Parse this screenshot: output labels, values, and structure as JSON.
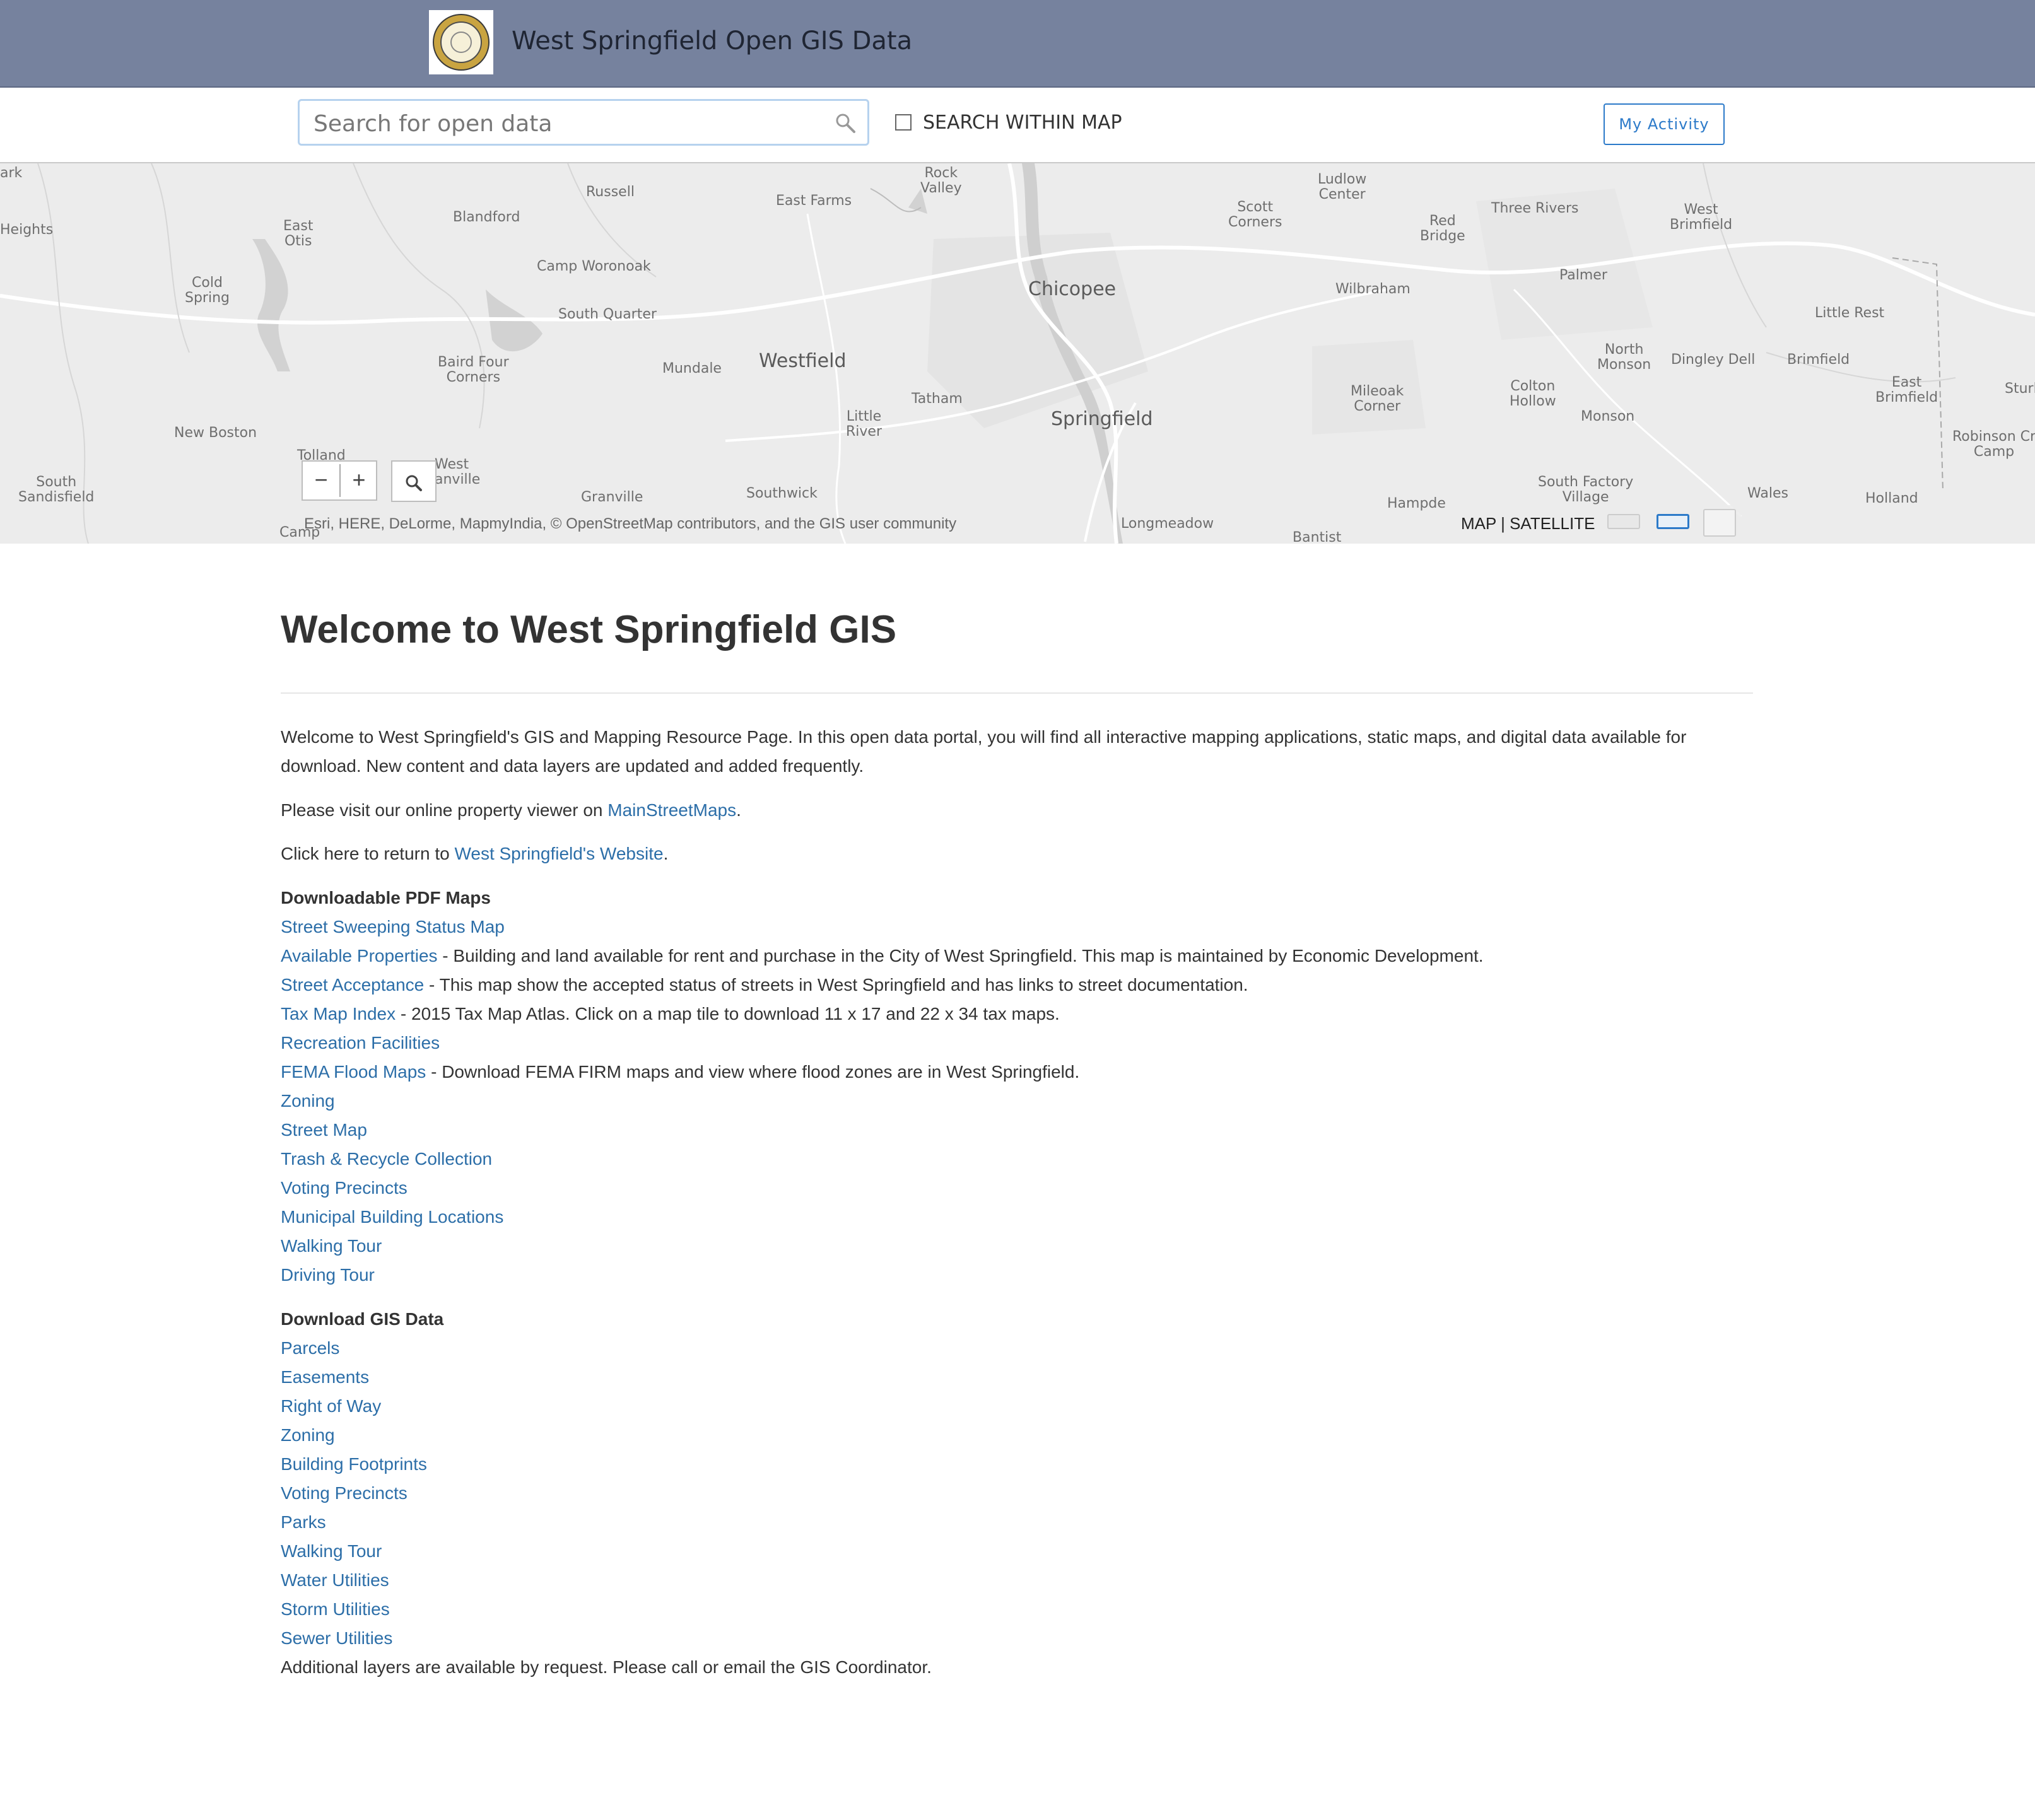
{
  "header": {
    "site_title": "West Springfield Open GIS Data"
  },
  "search": {
    "placeholder": "Search for open data",
    "value": "",
    "within_map_label": "SEARCH WITHIN MAP",
    "within_map_checked": false
  },
  "activity_button": "My Activity",
  "map": {
    "places": [
      {
        "name": "ark",
        "cls": ""
      },
      {
        "name": "Heights",
        "cls": ""
      },
      {
        "name": "East\nOtis",
        "cls": ""
      },
      {
        "name": "Cold\nSpring",
        "cls": ""
      },
      {
        "name": "Blandford",
        "cls": ""
      },
      {
        "name": "Russell",
        "cls": ""
      },
      {
        "name": "East Farms",
        "cls": ""
      },
      {
        "name": "Rock\nValley",
        "cls": ""
      },
      {
        "name": "Ludlow\nCenter",
        "cls": ""
      },
      {
        "name": "Scott\nCorners",
        "cls": ""
      },
      {
        "name": "Red\nBridge",
        "cls": ""
      },
      {
        "name": "Three Rivers",
        "cls": ""
      },
      {
        "name": "West\nBrimfield",
        "cls": ""
      },
      {
        "name": "Camp Woronoak",
        "cls": ""
      },
      {
        "name": "Chicopee",
        "cls": "big"
      },
      {
        "name": "Wilbraham",
        "cls": ""
      },
      {
        "name": "Palmer",
        "cls": ""
      },
      {
        "name": "South Quarter",
        "cls": ""
      },
      {
        "name": "Little Rest",
        "cls": ""
      },
      {
        "name": "Baird Four\nCorners",
        "cls": ""
      },
      {
        "name": "Mundale",
        "cls": ""
      },
      {
        "name": "Westfield",
        "cls": "big"
      },
      {
        "name": "North\nMonson",
        "cls": ""
      },
      {
        "name": "Dingley Dell",
        "cls": ""
      },
      {
        "name": "Brimfield",
        "cls": ""
      },
      {
        "name": "New Boston",
        "cls": ""
      },
      {
        "name": "Tatham",
        "cls": ""
      },
      {
        "name": "Little\nRiver",
        "cls": ""
      },
      {
        "name": "Springfield",
        "cls": "big"
      },
      {
        "name": "Mileoak\nCorner",
        "cls": ""
      },
      {
        "name": "Colton\nHollow",
        "cls": ""
      },
      {
        "name": "Monson",
        "cls": ""
      },
      {
        "name": "East\nBrimfield",
        "cls": ""
      },
      {
        "name": "Sturb",
        "cls": ""
      },
      {
        "name": "Tolland",
        "cls": ""
      },
      {
        "name": "West\nanville",
        "cls": ""
      },
      {
        "name": "South\nSandisfield",
        "cls": ""
      },
      {
        "name": "Granville",
        "cls": ""
      },
      {
        "name": "Southwick",
        "cls": ""
      },
      {
        "name": "Hampde",
        "cls": ""
      },
      {
        "name": "South Factory\nVillage",
        "cls": ""
      },
      {
        "name": "Wales",
        "cls": ""
      },
      {
        "name": "Holland",
        "cls": ""
      },
      {
        "name": "Robinson Cr\nCamp",
        "cls": ""
      },
      {
        "name": "Longmeadow",
        "cls": ""
      },
      {
        "name": "Camp",
        "cls": ""
      },
      {
        "name": "Bantist",
        "cls": ""
      }
    ],
    "zoom_out": "−",
    "zoom_in": "+",
    "attribution": "Esri, HERE, DeLorme, MapmyIndia, © OpenStreetMap contributors, and the GIS user community",
    "basemap_label": "MAP | SATELLITE"
  },
  "content": {
    "title": "Welcome to West Springfield GIS",
    "intro_line1": "Welcome to West Springfield's GIS and Mapping Resource Page. In this open data portal, you will find all interactive mapping applications, static maps, and digital data available for",
    "intro_line2": "download. New content and data layers are updated and added frequently.",
    "viewer_prefix": "Please visit our online property viewer on ",
    "viewer_link": "MainStreetMaps",
    "viewer_suffix": ".",
    "return_prefix": "Click here to return to ",
    "return_link": "West Springfield's Website",
    "return_suffix": ".",
    "pdf_title": "Downloadable PDF Maps",
    "pdf_items": [
      {
        "link": "Street Sweeping Status Map",
        "desc": ""
      },
      {
        "link": "Available Properties",
        "desc": " - Building and land available for rent and purchase in the City of West Springfield. This map is maintained by Economic Development."
      },
      {
        "link": "Street Acceptance",
        "desc": " - This map show the accepted status of streets in West Springfield and has links to street documentation."
      },
      {
        "link": "Tax Map Index",
        "desc": " - 2015 Tax Map Atlas. Click on a map tile to download 11 x 17 and 22 x 34 tax maps."
      },
      {
        "link": "Recreation Facilities",
        "desc": ""
      },
      {
        "link": "FEMA Flood Maps",
        "desc": " - Download FEMA FIRM maps and view where flood zones are in West Springfield."
      },
      {
        "link": "Zoning",
        "desc": ""
      },
      {
        "link": "Street Map",
        "desc": ""
      },
      {
        "link": "Trash & Recycle Collection",
        "desc": ""
      },
      {
        "link": "Voting Precincts",
        "desc": ""
      },
      {
        "link": "Municipal Building Locations",
        "desc": ""
      },
      {
        "link": "Walking Tour",
        "desc": ""
      },
      {
        "link": "Driving Tour",
        "desc": ""
      }
    ],
    "gis_title": "Download GIS Data",
    "gis_items": [
      "Parcels",
      "Easements",
      "Right of Way",
      "Zoning",
      "Building Footprints",
      "Voting Precincts",
      "Parks",
      "Walking Tour",
      "Water Utilities",
      "Storm Utilities",
      "Sewer Utilities"
    ],
    "footer_note": "Additional layers are available by request. Please call or email the GIS Coordinator."
  }
}
